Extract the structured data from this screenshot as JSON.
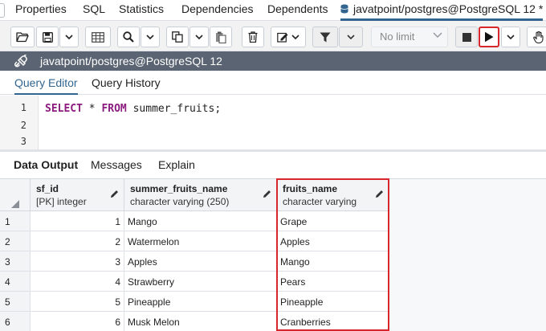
{
  "top_tabs": {
    "properties": "Properties",
    "sql": "SQL",
    "statistics": "Statistics",
    "dependencies": "Dependencies",
    "dependents": "Dependents",
    "query_tab": "javatpoint/postgres@PostgreSQL 12 *"
  },
  "toolbar": {
    "icons": [
      "folder-open-icon",
      "save-icon",
      "chevron-down-icon",
      "table-grid-icon",
      "search-icon",
      "chevron-down-icon",
      "copy-icon",
      "chevron-down-icon",
      "paste-icon",
      "trash-icon",
      "edit-icon",
      "chevron-down-icon",
      "filter-icon",
      "chevron-down-icon",
      "stop-icon",
      "execute-icon",
      "chevron-down-icon",
      "hand-icon"
    ],
    "row_limit": "No limit",
    "highlight_color": "#d7262c"
  },
  "connection": {
    "label": "javatpoint/postgres@PostgreSQL 12"
  },
  "editor_tabs": [
    "Query Editor",
    "Query History"
  ],
  "editor": {
    "line_numbers": [
      "1",
      "2",
      "3"
    ],
    "query": {
      "kw_select": "SELECT",
      "star": " * ",
      "kw_from": "FROM",
      "rest": " summer_fruits;"
    }
  },
  "output_tabs": [
    "Data Output",
    "Messages",
    "Explain"
  ],
  "grid": {
    "columns": [
      {
        "name": "sf_id",
        "type": "[PK] integer"
      },
      {
        "name": "summer_fruits_name",
        "type": "character varying (250)"
      },
      {
        "name": "fruits_name",
        "type": "character varying"
      }
    ],
    "rows": [
      {
        "num": "1",
        "sf_id": "1",
        "summer": "Mango",
        "fruits": "Grape"
      },
      {
        "num": "2",
        "sf_id": "2",
        "summer": "Watermelon",
        "fruits": "Apples"
      },
      {
        "num": "3",
        "sf_id": "3",
        "summer": "Apples",
        "fruits": "Mango"
      },
      {
        "num": "4",
        "sf_id": "4",
        "summer": "Strawberry",
        "fruits": "Pears"
      },
      {
        "num": "5",
        "sf_id": "5",
        "summer": "Pineapple",
        "fruits": "Pineapple"
      },
      {
        "num": "6",
        "sf_id": "6",
        "summer": "Musk Melon",
        "fruits": "Cranberries"
      }
    ]
  },
  "colors": {
    "accent": "#326690",
    "connection_bar": "#5b6472",
    "keyword": "#8b1b7e",
    "highlight": "#d7262c"
  }
}
